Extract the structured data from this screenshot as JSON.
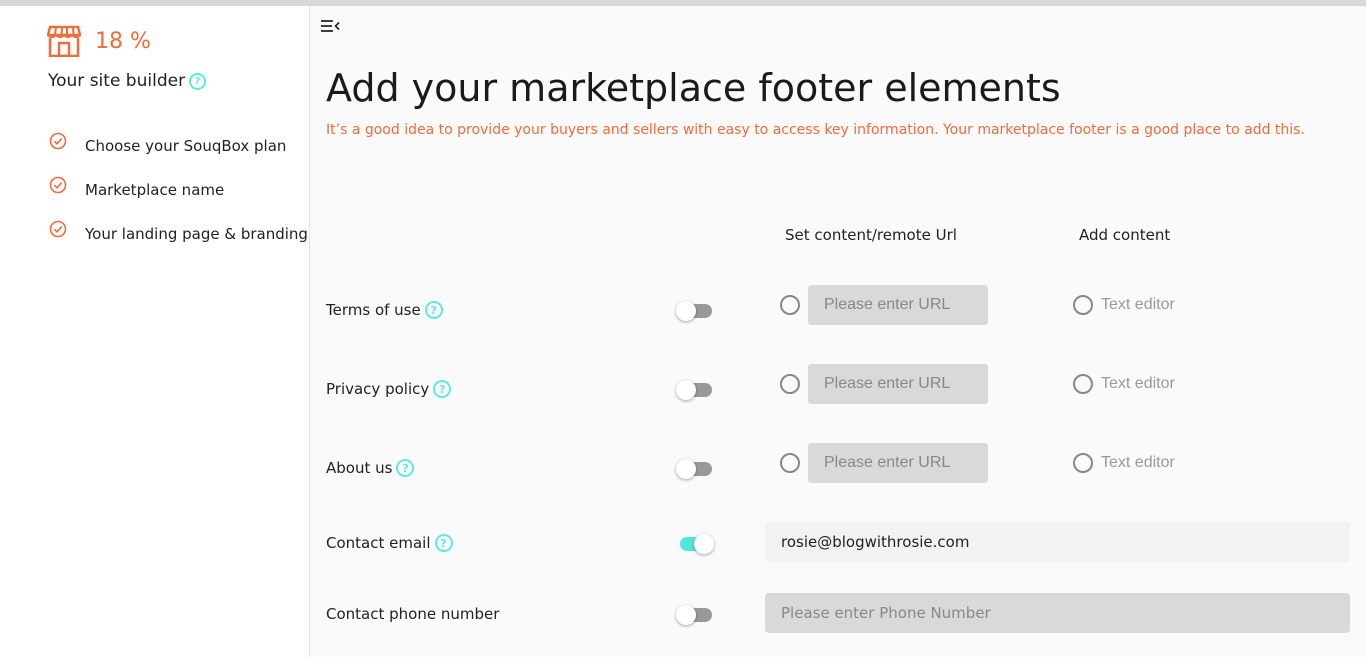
{
  "sidebar": {
    "progress_percent": "18 %",
    "progress_icon": "storefront-icon",
    "title": "Your site builder",
    "steps": [
      {
        "label": "Choose your SouqBox plan",
        "icon": "check-circle-icon"
      },
      {
        "label": "Marketplace name",
        "icon": "check-circle-icon"
      },
      {
        "label": "Your landing page & branding",
        "icon": "check-circle-icon"
      }
    ]
  },
  "main": {
    "menu_icon": "collapse-menu-icon",
    "title": "Add your marketplace footer elements",
    "subtitle": "It’s a good idea to provide your buyers and sellers with easy to access key information. Your marketplace footer is a good place to add this.",
    "columns": {
      "url": "Set content/remote Url",
      "content": "Add content"
    },
    "rows": [
      {
        "label": "Terms of use",
        "help": "?",
        "enabled": false,
        "url_placeholder": "Please enter URL",
        "editor_label": "Text editor"
      },
      {
        "label": "Privacy policy",
        "help": "?",
        "enabled": false,
        "url_placeholder": "Please enter URL",
        "editor_label": "Text editor"
      },
      {
        "label": "About us",
        "help": "?",
        "enabled": false,
        "url_placeholder": "Please enter URL",
        "editor_label": "Text editor"
      }
    ],
    "contact_email": {
      "label": "Contact email",
      "help": "?",
      "enabled": true,
      "value": "rosie@blogwithrosie.com"
    },
    "contact_phone": {
      "label": "Contact phone number",
      "enabled": false,
      "placeholder": "Please enter Phone Number",
      "value": ""
    }
  },
  "colors": {
    "accent": "#f26b3a",
    "toggle_on": "#4ee8e0",
    "help": "#5ee8e8"
  }
}
